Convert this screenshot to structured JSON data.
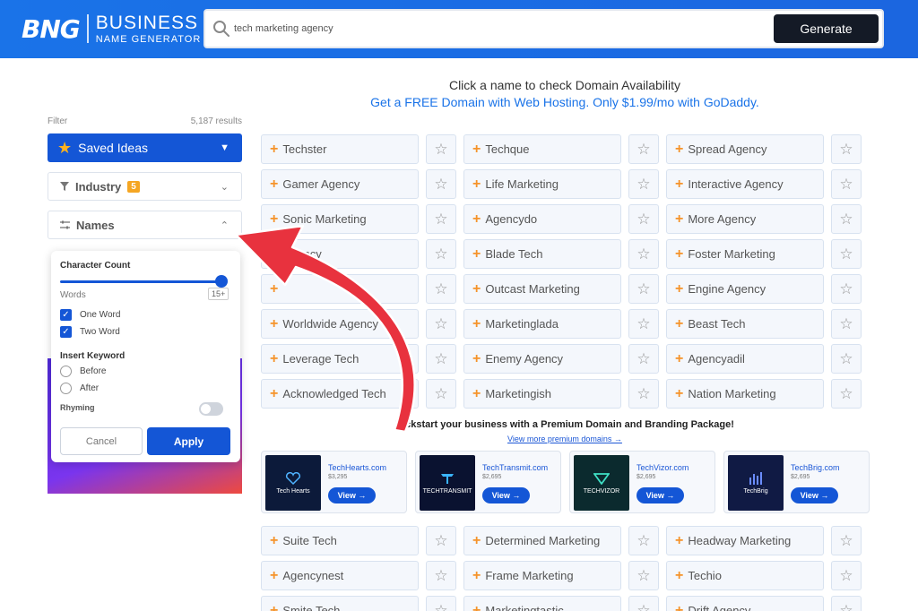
{
  "header": {
    "logo_mark": "BNG",
    "logo_line1": "BUSINESS",
    "logo_line2": "NAME GENERATOR",
    "search_value": "tech marketing agency",
    "generate_label": "Generate"
  },
  "intro": {
    "line1": "Click a name to check Domain Availability",
    "line2": "Get a FREE Domain with Web Hosting. Only $1.99/mo with GoDaddy."
  },
  "sidebar": {
    "filter_label": "Filter",
    "results_count": "5,187 results",
    "saved_ideas": "Saved Ideas",
    "industry": "Industry",
    "industry_badge": "5",
    "names": "Names"
  },
  "names_panel": {
    "character_count": "Character Count",
    "slider_value": "15+",
    "words": "Words",
    "one_word": "One Word",
    "two_word": "Two Word",
    "insert_keyword": "Insert Keyword",
    "before": "Before",
    "after": "After",
    "rhyming": "Rhyming",
    "cancel": "Cancel",
    "apply": "Apply"
  },
  "names_top": [
    "Techster",
    "Techque",
    "Spread Agency",
    "Gamer Agency",
    "Life Marketing",
    "Interactive Agency",
    "Sonic Marketing",
    "Agencydo",
    "More Agency",
    "Agency",
    "Blade Tech",
    "Foster Marketing",
    "",
    "Outcast Marketing",
    "Engine Agency",
    "Worldwide Agency",
    "Marketinglada",
    "Beast Tech",
    "Leverage Tech",
    "Enemy Agency",
    "Agencyadil",
    "Acknowledged Tech",
    "Marketingish",
    "Nation Marketing"
  ],
  "premium": {
    "title": "Kickstart your business with a Premium Domain and Branding Package!",
    "link": "View more premium domains →",
    "view_label": "View →",
    "cards": [
      {
        "domain": "TechHearts.com",
        "price": "$3,295",
        "logo": "Tech Hearts"
      },
      {
        "domain": "TechTransmit.com",
        "price": "$2,695",
        "logo": "TECHTRANSMIT"
      },
      {
        "domain": "TechVizor.com",
        "price": "$2,695",
        "logo": "TECHVIZOR"
      },
      {
        "domain": "TechBrig.com",
        "price": "$2,695",
        "logo": "TechBrig"
      }
    ]
  },
  "names_bottom": [
    "Suite Tech",
    "Determined Marketing",
    "Headway Marketing",
    "Agencynest",
    "Frame Marketing",
    "Techio",
    "Smite Tech",
    "Marketingtastic",
    "Drift Agency"
  ],
  "colors": {
    "header_blue": "#1a73e8",
    "primary": "#1456d6",
    "accent_orange": "#f5932a",
    "star_yellow": "#ffb21e",
    "arrow_red": "#e8323e"
  },
  "icons": {
    "search": "search-icon",
    "star": "star-icon",
    "plus": "plus-icon",
    "filter": "filter-icon",
    "sliders": "sliders-icon",
    "chevron": "chevron-icon",
    "check": "check-icon"
  }
}
